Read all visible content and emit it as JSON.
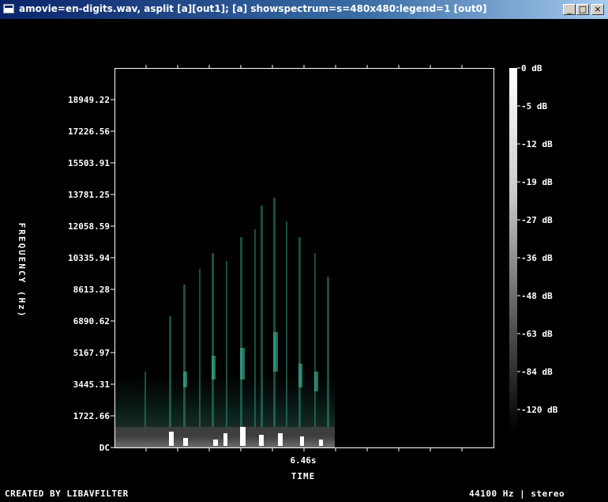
{
  "window": {
    "title": "amovie=en-digits.wav, asplit [a][out1]; [a] showspectrum=s=480x480:legend=1 [out0]",
    "buttons": {
      "minimize": "_",
      "maximize": "□",
      "close": "×"
    }
  },
  "spectrum": {
    "y_axis_label": "FREQUENCY (Hz)",
    "x_axis_label": "TIME",
    "frequency_ticks": [
      "18949.22",
      "17226.56",
      "15503.91",
      "13781.25",
      "12058.59",
      "10335.94",
      "8613.28",
      "6890.62",
      "5167.97",
      "3445.31",
      "1722.66",
      "DC"
    ],
    "time_tick": "6.46s",
    "db_scale": [
      "0 dB",
      "-5 dB",
      "-12 dB",
      "-19 dB",
      "-27 dB",
      "-36 dB",
      "-48 dB",
      "-63 dB",
      "-84 dB",
      "-120 dB"
    ],
    "footer_left": "CREATED BY LIBAVFILTER",
    "footer_right": "44100 Hz | stereo"
  },
  "colors": {
    "background": "#000000",
    "title_bar": "#0a246a",
    "text": "#ffffff",
    "spectrum_accent": "#2a7f6a"
  }
}
